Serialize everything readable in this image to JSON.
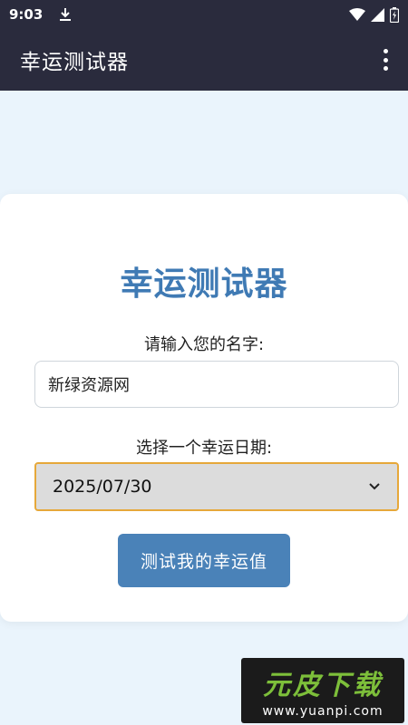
{
  "status_bar": {
    "time": "9:03",
    "icons": [
      "download-icon",
      "wifi-icon",
      "signal-icon",
      "battery-icon"
    ]
  },
  "app_bar": {
    "title": "幸运测试器",
    "menu_icon": "more-vert-icon"
  },
  "form": {
    "heading": "幸运测试器",
    "name_label": "请输入您的名字:",
    "name_value": "新绿资源网",
    "date_label": "选择一个幸运日期:",
    "date_value": "2025/07/30",
    "submit_label": "测试我的幸运值"
  },
  "watermark": {
    "main": "元皮下载",
    "sub": "www.yuanpi.com"
  },
  "colors": {
    "app_bar": "#2a2b3d",
    "background": "#eaf4fc",
    "heading": "#3f7ab4",
    "button": "#4a82b8",
    "select_border": "#e6a83a"
  }
}
